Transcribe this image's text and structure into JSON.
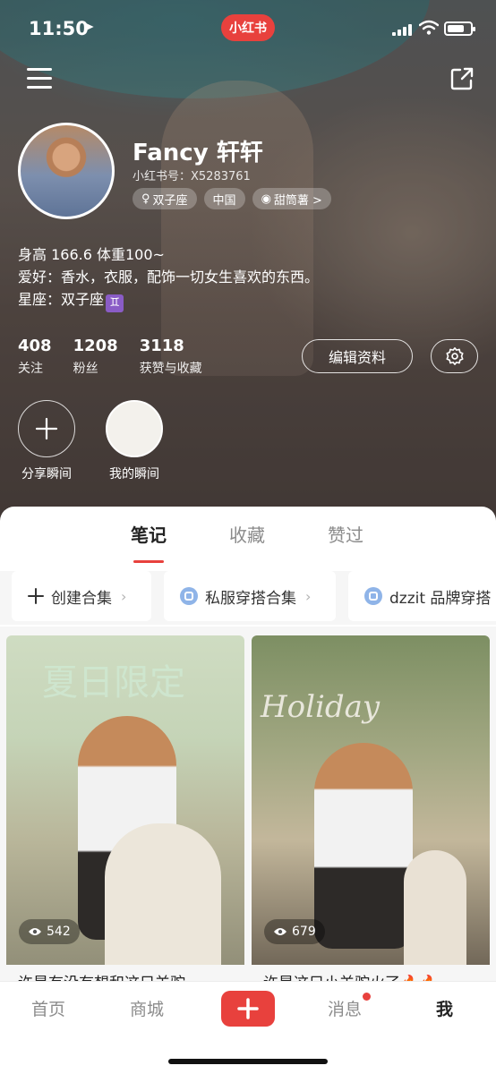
{
  "status_bar": {
    "time": "11:50",
    "brand": "小红书"
  },
  "profile": {
    "username": "Fancy 轩轩",
    "user_id_label": "小红书号：X5283761",
    "tags": [
      {
        "icon": "female-icon",
        "label": "双子座"
      },
      {
        "icon": "",
        "label": "中国"
      },
      {
        "icon": "badge-icon",
        "label": "甜筒薯 >"
      }
    ],
    "bio": [
      "身高 166.6 体重100~",
      "爱好：香水，衣服，配饰一切女生喜欢的东西。",
      "星座：双子座"
    ],
    "zodiac_symbol": "♊"
  },
  "stats": [
    {
      "num": "408",
      "label": "关注"
    },
    {
      "num": "1208",
      "label": "粉丝"
    },
    {
      "num": "3118",
      "label": "获赞与收藏"
    }
  ],
  "buttons": {
    "edit_profile": "编辑资料"
  },
  "moments": [
    {
      "label": "分享瞬间"
    },
    {
      "label": "我的瞬间"
    }
  ],
  "tabs": [
    "笔记",
    "收藏",
    "赞过"
  ],
  "active_tab": 0,
  "collections": [
    {
      "label": "创建合集"
    },
    {
      "label": "私服穿搭合集"
    },
    {
      "label": "dzzit 品牌穿搭"
    }
  ],
  "notes": [
    {
      "art_text": "夏日限定",
      "views": "542",
      "title": "许是有没有想和这只羊驼一"
    },
    {
      "art_text": "Holiday",
      "views": "679",
      "title": "许是这只小羊驼火了🔥🔥"
    }
  ],
  "bottom_nav": {
    "home": "首页",
    "mall": "商城",
    "messages": "消息",
    "me": "我"
  },
  "colors": {
    "accent": "#e8413d",
    "text_primary": "#222222",
    "text_secondary": "#8c8c8c"
  }
}
